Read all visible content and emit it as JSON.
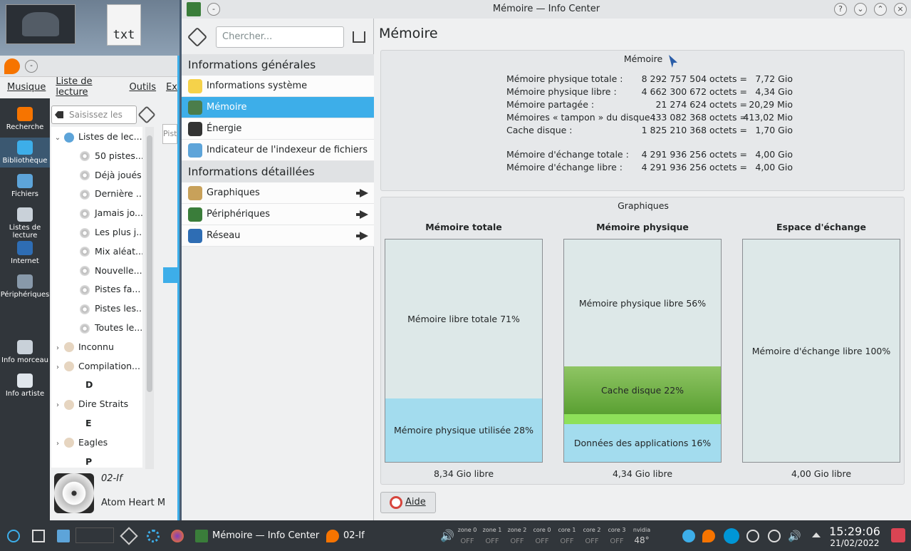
{
  "desktop": {
    "file_label": "txt"
  },
  "amarok": {
    "menu": [
      "Musique",
      "Liste de lecture",
      "Outils",
      "Ex"
    ],
    "sidebar": [
      {
        "label": "Recherche",
        "icon": "search-icon"
      },
      {
        "label": "Bibliothèque",
        "icon": "library-icon"
      },
      {
        "label": "Fichiers",
        "icon": "files-icon"
      },
      {
        "label": "Listes de lecture",
        "icon": "playlists-icon"
      },
      {
        "label": "Internet",
        "icon": "internet-icon"
      },
      {
        "label": "Périphériques",
        "icon": "devices-icon"
      },
      {
        "label": "Info morceau",
        "icon": "track-info-icon"
      },
      {
        "label": "Info artiste",
        "icon": "artist-info-icon"
      }
    ],
    "search_placeholder": "Saisissez les t...",
    "tree": [
      {
        "label": "Listes de lec...",
        "level": 0
      },
      {
        "label": "50 pistes...",
        "level": 1
      },
      {
        "label": "Déjà joués",
        "level": 1
      },
      {
        "label": "Dernière ...",
        "level": 1
      },
      {
        "label": "Jamais jo...",
        "level": 1
      },
      {
        "label": "Les plus j...",
        "level": 1
      },
      {
        "label": "Mix aléat...",
        "level": 1
      },
      {
        "label": "Nouvelle...",
        "level": 1
      },
      {
        "label": "Pistes fa...",
        "level": 1
      },
      {
        "label": "Pistes les...",
        "level": 1
      },
      {
        "label": "Toutes le...",
        "level": 1
      },
      {
        "label": "Inconnu",
        "level": 0
      },
      {
        "label": "Compilation...",
        "level": 0
      },
      {
        "label": "D",
        "level": 2
      },
      {
        "label": "Dire Straits",
        "level": 0
      },
      {
        "label": "E",
        "level": 2
      },
      {
        "label": "Eagles",
        "level": 0
      },
      {
        "label": "P",
        "level": 2
      }
    ],
    "now_playing": {
      "track": "02-If",
      "album": "Atom Heart M"
    },
    "tab_stub": "Pist"
  },
  "infocenter": {
    "window_title": "Mémoire — Info Center",
    "search_placeholder": "Chercher...",
    "categories": [
      {
        "title": "Informations générales",
        "items": [
          {
            "label": "Informations système",
            "icon": "lightbulb-icon",
            "selected": false,
            "arrow": false
          },
          {
            "label": "Mémoire",
            "icon": "memory-icon",
            "selected": true,
            "arrow": false
          },
          {
            "label": "Énergie",
            "icon": "battery-icon",
            "selected": false,
            "arrow": false
          },
          {
            "label": "Indicateur de l'indexeur de fichiers",
            "icon": "indexer-icon",
            "selected": false,
            "arrow": false
          }
        ]
      },
      {
        "title": "Informations détaillées",
        "items": [
          {
            "label": "Graphiques",
            "icon": "palette-icon",
            "selected": false,
            "arrow": true
          },
          {
            "label": "Périphériques",
            "icon": "devices-icon",
            "selected": false,
            "arrow": true
          },
          {
            "label": "Réseau",
            "icon": "network-icon",
            "selected": false,
            "arrow": true
          }
        ]
      }
    ],
    "page_title": "Mémoire",
    "memory": {
      "section_title": "Mémoire",
      "rows": [
        {
          "label": "Mémoire physique totale :",
          "bytes": "8 292 757 504 octets =",
          "human": "7,72 Gio"
        },
        {
          "label": "Mémoire physique libre :",
          "bytes": "4 662 300 672 octets =",
          "human": "4,34 Gio"
        },
        {
          "label": "Mémoire partagée :",
          "bytes": "21 274 624 octets =",
          "human": "20,29 Mio"
        },
        {
          "label": "Mémoires « tampon » du disque :",
          "bytes": "433 082 368 octets =",
          "human": "413,02 Mio"
        },
        {
          "label": "Cache disque :",
          "bytes": "1 825 210 368 octets =",
          "human": "1,70 Gio"
        },
        {
          "label": "Mémoire d'échange totale :",
          "bytes": "4 291 936 256 octets =",
          "human": "4,00 Gio"
        },
        {
          "label": "Mémoire d'échange libre :",
          "bytes": "4 291 936 256 octets =",
          "human": "4,00 Gio"
        }
      ]
    },
    "graphs": {
      "section_title": "Graphiques",
      "columns": [
        {
          "title": "Mémoire totale",
          "footer": "8,34 Gio libre",
          "segments": [
            {
              "label": "Mémoire libre totale 71%",
              "fraction": 0.715,
              "color": "#dde8e8"
            },
            {
              "label": "Mémoire physique utilisée 28%",
              "fraction": 0.285,
              "color": "#a3dcee"
            }
          ]
        },
        {
          "title": "Mémoire physique",
          "footer": "4,34 Gio libre",
          "segments": [
            {
              "label": "Mémoire physique libre 56%",
              "fraction": 0.57,
              "color": "#dde8e8"
            },
            {
              "label": "Cache disque 22%",
              "fraction": 0.215,
              "color": "gradient-green"
            },
            {
              "label": "",
              "fraction": 0.045,
              "color": "#8ee05a"
            },
            {
              "label": "Données des applications 16%",
              "fraction": 0.17,
              "color": "#a3dcee"
            }
          ]
        },
        {
          "title": "Espace d'échange",
          "footer": "4,00 Gio libre",
          "segments": [
            {
              "label": "Mémoire d'échange libre 100%",
              "fraction": 1.0,
              "color": "#dde8e8"
            }
          ]
        }
      ]
    },
    "help_button": "Aide"
  },
  "taskbar": {
    "tasks": [
      {
        "label": "Mémoire — Info Center",
        "icon": "infocenter-icon"
      },
      {
        "label": "02-If",
        "icon": "amarok-icon"
      }
    ],
    "sensors": [
      {
        "name": "zone 0",
        "value": "OFF"
      },
      {
        "name": "zone 1",
        "value": "OFF"
      },
      {
        "name": "zone 2",
        "value": "OFF"
      },
      {
        "name": "core 0",
        "value": "OFF"
      },
      {
        "name": "core 1",
        "value": "OFF"
      },
      {
        "name": "core 2",
        "value": "OFF"
      },
      {
        "name": "core 3",
        "value": "OFF"
      },
      {
        "name": "nvidia",
        "value": "48°"
      }
    ],
    "clock": {
      "time": "15:29:06",
      "date": "21/02/2022"
    },
    "accent": "#3daee9"
  }
}
